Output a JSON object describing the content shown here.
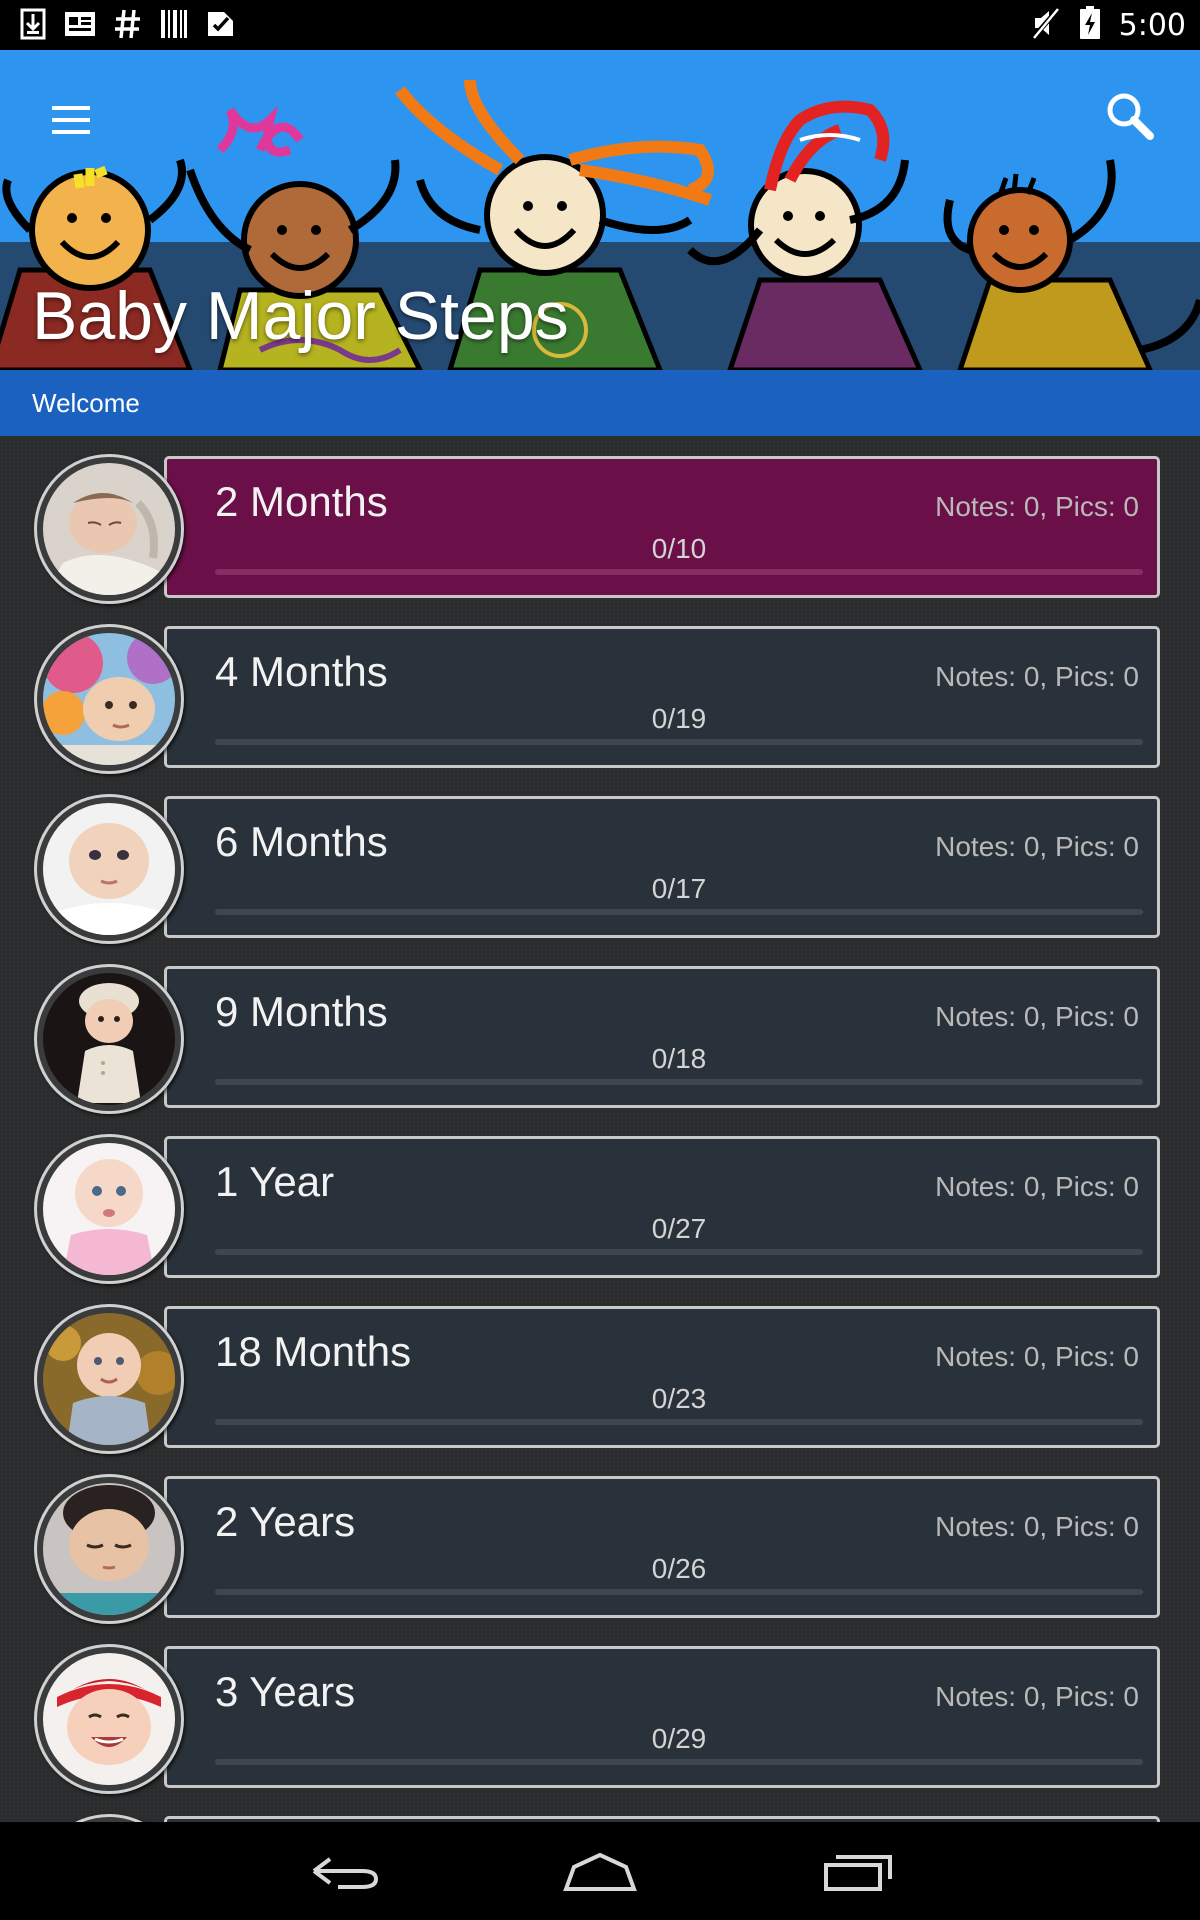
{
  "status_bar": {
    "left_icons": [
      "download-icon",
      "news-icon",
      "hashtag-icon",
      "barcode-icon",
      "play-store-icon"
    ],
    "right_icons": [
      "volume-muted-icon",
      "battery-charging-icon"
    ],
    "time": "5:00"
  },
  "header": {
    "title": "Baby Major Steps",
    "menu_icon": "hamburger-menu-icon",
    "search_icon": "search-icon",
    "colors": {
      "sky": "#2d95ef",
      "title_band": "#2a4e7a"
    }
  },
  "tabs": {
    "active_label": "Welcome",
    "color": "#1b61c0"
  },
  "milestones": [
    {
      "title": "2 Months",
      "notes_label": "Notes: 0, Pics: 0",
      "count": "0/10",
      "progress": 0,
      "selected": true
    },
    {
      "title": "4 Months",
      "notes_label": "Notes: 0, Pics: 0",
      "count": "0/19",
      "progress": 0,
      "selected": false
    },
    {
      "title": "6 Months",
      "notes_label": "Notes: 0, Pics: 0",
      "count": "0/17",
      "progress": 0,
      "selected": false
    },
    {
      "title": "9 Months",
      "notes_label": "Notes: 0, Pics: 0",
      "count": "0/18",
      "progress": 0,
      "selected": false
    },
    {
      "title": "1 Year",
      "notes_label": "Notes: 0, Pics: 0",
      "count": "0/27",
      "progress": 0,
      "selected": false
    },
    {
      "title": "18 Months",
      "notes_label": "Notes: 0, Pics: 0",
      "count": "0/23",
      "progress": 0,
      "selected": false
    },
    {
      "title": "2 Years",
      "notes_label": "Notes: 0, Pics: 0",
      "count": "0/26",
      "progress": 0,
      "selected": false
    },
    {
      "title": "3 Years",
      "notes_label": "Notes: 0, Pics: 0",
      "count": "0/29",
      "progress": 0,
      "selected": false
    }
  ],
  "card_colors": {
    "default": "#29323a",
    "selected": "#6a0f47",
    "border": "#c8c8c8"
  },
  "nav_bar": {
    "back_icon": "back-icon",
    "home_icon": "home-icon",
    "recents_icon": "recent-apps-icon"
  }
}
